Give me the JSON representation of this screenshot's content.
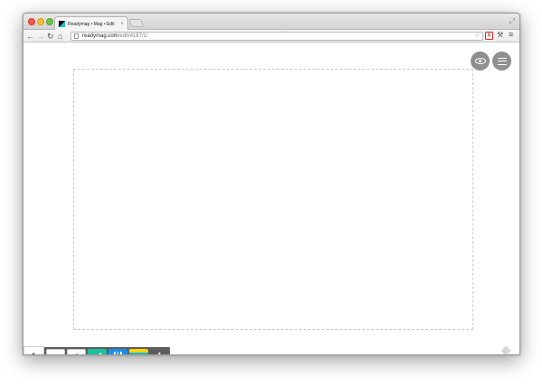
{
  "browser": {
    "tab_title": "Readymag • Mag • Edit",
    "tab_close": "×",
    "url_host": "readymag.com",
    "url_path": "/edit/4187/1/",
    "nav": {
      "back": "←",
      "forward": "→",
      "reload": "↻",
      "home": "⌂"
    },
    "extension_label": "c",
    "bookmark_star": "☆",
    "wrench": "🔧",
    "menu": "≡",
    "fullscreen": "⤢"
  },
  "editor": {
    "page_number": "1",
    "widgets": {
      "undo_symbol": "↶",
      "undo_sub": "⟲",
      "text_label": "i",
      "bg_label": "bg",
      "add_label": "+"
    }
  },
  "colors": {
    "shape_widget": "#19c29e",
    "grid_widget": "#1a8ee6",
    "panel": "#5c5c5c",
    "round_buttons": "#8f8f8f"
  },
  "icons": [
    "eye-icon",
    "menu-lines-icon",
    "undo-icon",
    "text-icon",
    "shape-icon",
    "grid-icon",
    "background-icon",
    "add-icon",
    "eraser-icon"
  ]
}
